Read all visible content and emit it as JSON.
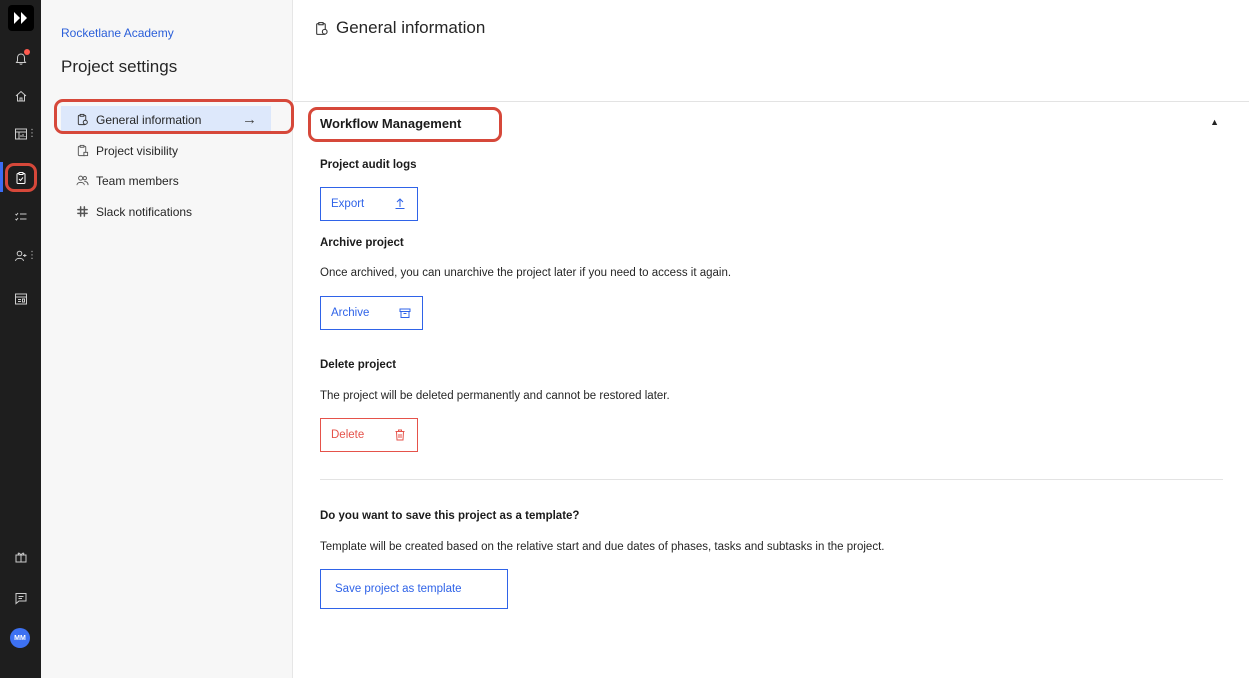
{
  "rail": {
    "avatar_initials": "MM",
    "icons": [
      "logo-icon",
      "bell-icon",
      "home-icon",
      "dashboard-icon",
      "projects-icon",
      "tasks-icon",
      "people-icon",
      "templates-icon",
      "gift-icon",
      "chat-icon"
    ]
  },
  "sidebar": {
    "workspace": "Rocketlane Academy",
    "title": "Project settings",
    "items": [
      {
        "label": "General information",
        "icon": "clipboard-gear-icon"
      },
      {
        "label": "Project visibility",
        "icon": "clipboard-lock-icon"
      },
      {
        "label": "Team members",
        "icon": "people-icon"
      },
      {
        "label": "Slack notifications",
        "icon": "slack-icon"
      }
    ]
  },
  "main": {
    "header": "General information",
    "section_title": "Workflow Management",
    "audit": {
      "label": "Project audit logs",
      "button": "Export"
    },
    "archive": {
      "label": "Archive project",
      "desc": "Once archived, you can unarchive the project later if you need to access it again.",
      "button": "Archive"
    },
    "delete": {
      "label": "Delete project",
      "desc": "The project will be deleted permanently and cannot be restored later.",
      "button": "Delete"
    },
    "template": {
      "label": "Do you want to save this project as a template?",
      "desc": "Template will be created based on the relative start and due dates of phases, tasks and subtasks in the project.",
      "button": "Save project as template"
    }
  },
  "colors": {
    "accent": "#2f63e8",
    "danger": "#e5524a",
    "highlight": "#d6483a",
    "rail": "#1e1e1e"
  }
}
